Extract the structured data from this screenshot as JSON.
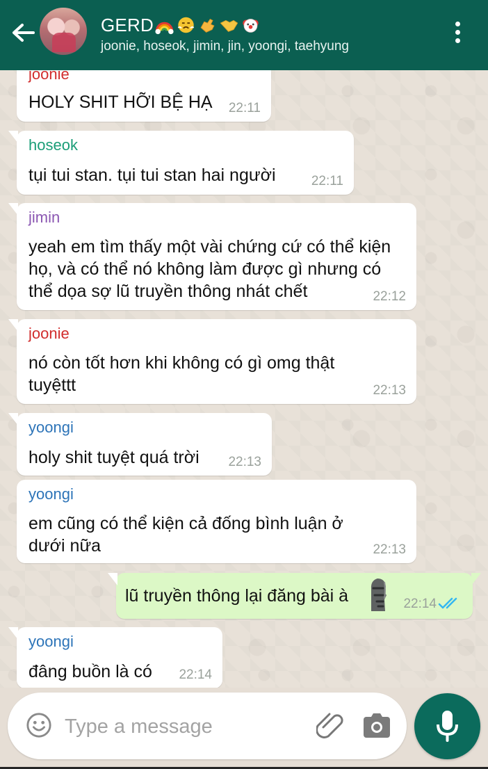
{
  "header": {
    "title": "GERD",
    "participants": "joonie, hoseok, jimin, jin, yoongi, taehyung",
    "title_emojis": [
      "rainbow-icon",
      "steam-face-icon",
      "call-me-hand-icon",
      "handshake-icon",
      "clown-face-icon"
    ]
  },
  "messages": [
    {
      "sender": "joonie",
      "text": "HOLY SHIT HỠI BỆ HẠ",
      "time": "22:11"
    },
    {
      "sender": "hoseok",
      "text": "tụi tui stan. tụi tui stan hai người",
      "time": "22:11"
    },
    {
      "sender": "jimin",
      "lines": [
        "yeah em tìm thấy một vài chứng cứ có thể kiện",
        "họ, và có thể nó không làm được gì nhưng có",
        "thể dọa sợ lũ truyền thông nhát chết"
      ],
      "time": "22:12"
    },
    {
      "sender": "joonie",
      "lines": [
        "nó còn tốt hơn khi không có gì omg thật",
        "tuyệttt"
      ],
      "time": "22:13"
    },
    {
      "sender": "yoongi",
      "text": "holy shit tuyệt quá trời",
      "time": "22:13"
    },
    {
      "sender": "yoongi",
      "lines": [
        "em cũng có thể kiện cả đống bình luận ở",
        "dưới nữa"
      ],
      "time": "22:13"
    },
    {
      "text": "lũ truyền thông lại đăng bài à",
      "emoji": "moai-icon",
      "time": "22:14",
      "status": "read"
    },
    {
      "sender": "yoongi",
      "text": "đâng buồn là có",
      "time": "22:14"
    }
  ],
  "composer": {
    "placeholder": "Type a message"
  },
  "colors": {
    "header": "#0b5f51",
    "joonie": "#d12d2d",
    "hoseok": "#1a9d77",
    "jimin": "#8b57b2",
    "yoongi": "#2d74b8",
    "outgoing_bubble": "#dcf8c6",
    "read_ticks": "#34b7f1"
  }
}
